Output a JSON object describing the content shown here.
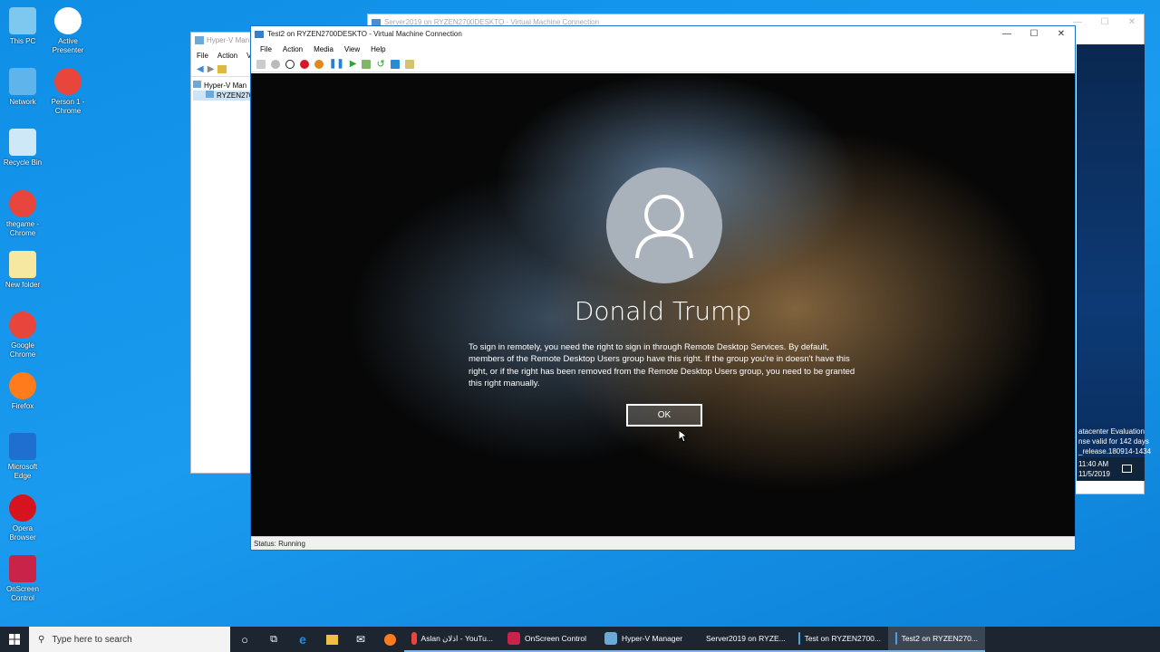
{
  "desktop_icons": [
    {
      "label": "This PC",
      "icon": "computer-icon",
      "color": "#7ec8f0"
    },
    {
      "label": "Active Presenter",
      "icon": "activepresenter-icon",
      "color": "#ffffff"
    },
    {
      "label": "Network",
      "icon": "network-icon",
      "color": "#5fb4ec"
    },
    {
      "label": "Person 1 - Chrome",
      "icon": "chrome-icon",
      "color": "#e8453c"
    },
    {
      "label": "Recycle Bin",
      "icon": "recycle-bin-icon",
      "color": "#cfe8f8"
    },
    {
      "label": "thegame - Chrome",
      "icon": "chrome-icon",
      "color": "#e8453c"
    },
    {
      "label": "New folder",
      "icon": "folder-icon",
      "color": "#f6e7a1"
    },
    {
      "label": "Google Chrome",
      "icon": "chrome-icon",
      "color": "#e8453c"
    },
    {
      "label": "Firefox",
      "icon": "firefox-icon",
      "color": "#ff7b1c"
    },
    {
      "label": "Microsoft Edge",
      "icon": "edge-icon",
      "color": "#1f6fd0"
    },
    {
      "label": "Opera Browser",
      "icon": "opera-icon",
      "color": "#d5141f"
    },
    {
      "label": "OnScreen Control",
      "icon": "onscreen-control-icon",
      "color": "#c9234a"
    }
  ],
  "back_window": {
    "title": "Server2019 on RYZEN2700DESKTO - Virtual Machine Connection",
    "watermark": [
      "atacenter Evaluation",
      "nse valid for 142 days",
      "_release.180914-1434"
    ],
    "time": "11:40 AM",
    "date": "11/5/2019"
  },
  "hyperv": {
    "title": "Hyper-V Man",
    "menu": [
      "File",
      "Action",
      "V"
    ],
    "tree": [
      "Hyper-V Man",
      "RYZEN270"
    ]
  },
  "vm": {
    "title": "Test2 on RYZEN2700DESKTO - Virtual Machine Connection",
    "menu": [
      "File",
      "Action",
      "Media",
      "View",
      "Help"
    ],
    "user_name": "Donald Trump",
    "message": "To sign in remotely, you need the right to sign in through Remote Desktop Services. By default, members of the Remote Desktop Users group have this right. If the group you're in doesn't have this right, or if the right has been removed from the Remote Desktop Users group, you need to be granted this right manually.",
    "ok_label": "OK",
    "status": "Status: Running"
  },
  "taskbar": {
    "search_placeholder": "Type here to search",
    "apps": [
      {
        "label": "Aslan اذلان - YouTu...",
        "color": "#e8453c"
      },
      {
        "label": "OnScreen Control",
        "color": "#c9234a"
      },
      {
        "label": "Hyper-V Manager",
        "color": "#6aa9d8"
      },
      {
        "label": "Server2019 on RYZE...",
        "color": "#4aa0e0"
      },
      {
        "label": "Test on RYZEN2700...",
        "color": "#4aa0e0"
      },
      {
        "label": "Test2 on RYZEN270...",
        "color": "#4aa0e0"
      }
    ]
  }
}
